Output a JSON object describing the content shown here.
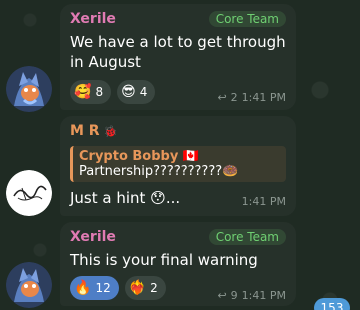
{
  "colors": {
    "background": "#1f2b23",
    "bubble": "#26312a",
    "sender_pink": "#e07bb3",
    "sender_orange": "#e8975a",
    "role_green": "#6fcf72",
    "active_reaction": "#4e7ec6",
    "badge": "#4e9ad8"
  },
  "messages": [
    {
      "sender": "Xerile",
      "role": "Core Team",
      "text": "We have a lot to get through in August",
      "reactions": [
        {
          "icon": "heart-face-emoji",
          "glyph": "🥰",
          "count": "8"
        },
        {
          "icon": "sunglasses-emoji",
          "glyph": "😎",
          "count": "4"
        }
      ],
      "replies": "2",
      "time": "1:41 PM"
    },
    {
      "sender": "M R",
      "sender_badge": "🐞",
      "quote_name": "Crypto Bobby 🇨🇦",
      "quote_text": "Partnership??????????🍩",
      "text": "Just a hint 😯...",
      "time": "1:41 PM"
    },
    {
      "sender": "Xerile",
      "role": "Core Team",
      "text": "This is your final warning",
      "reactions": [
        {
          "icon": "fire-emoji",
          "glyph": "🔥",
          "count": "12"
        },
        {
          "icon": "heart-on-fire-emoji",
          "glyph": "❤️‍🔥",
          "count": "2"
        }
      ],
      "replies": "9",
      "time": "1:41 PM"
    }
  ],
  "unread_count": "153"
}
